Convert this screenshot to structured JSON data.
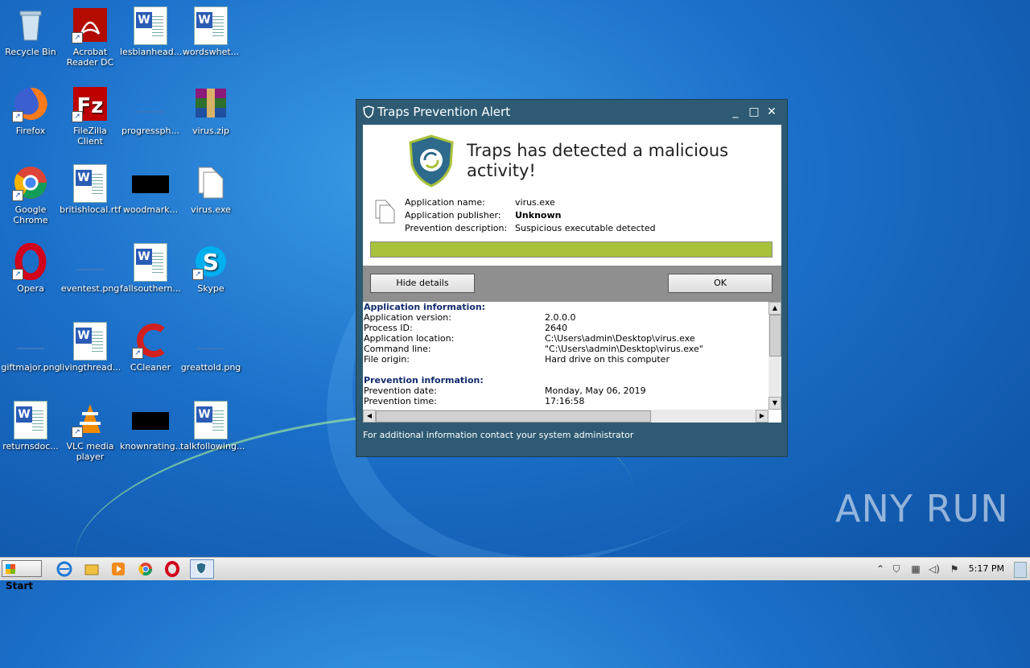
{
  "desktop": {
    "icons": [
      {
        "label": "Recycle Bin",
        "type": "recycle"
      },
      {
        "label": "Acrobat Reader DC",
        "type": "acrobat"
      },
      {
        "label": "lesbianhead...",
        "type": "word"
      },
      {
        "label": "wordswhet...",
        "type": "word"
      },
      {
        "label": "Firefox",
        "type": "firefox"
      },
      {
        "label": "FileZilla Client",
        "type": "filezilla"
      },
      {
        "label": "progressph...",
        "type": "blank"
      },
      {
        "label": "virus.zip",
        "type": "zip"
      },
      {
        "label": "Google Chrome",
        "type": "chrome"
      },
      {
        "label": "britishlocal.rtf",
        "type": "word"
      },
      {
        "label": "woodmark...",
        "type": "black"
      },
      {
        "label": "virus.exe",
        "type": "exe"
      },
      {
        "label": "Opera",
        "type": "opera"
      },
      {
        "label": "eventest.png",
        "type": "blank"
      },
      {
        "label": "fallsouthern...",
        "type": "word"
      },
      {
        "label": "Skype",
        "type": "skype"
      },
      {
        "label": "giftmajor.png",
        "type": "blank"
      },
      {
        "label": "livingthread...",
        "type": "word"
      },
      {
        "label": "CCleaner",
        "type": "ccleaner"
      },
      {
        "label": "greattold.png",
        "type": "blank"
      },
      {
        "label": "returnsdoc...",
        "type": "word"
      },
      {
        "label": "VLC media player",
        "type": "vlc"
      },
      {
        "label": "knownrating...",
        "type": "black"
      },
      {
        "label": "talkfollowing...",
        "type": "word"
      }
    ]
  },
  "dialog": {
    "title": "Traps Prevention Alert",
    "headline": "Traps has detected a malicious activity!",
    "app_name_label": "Application name:",
    "app_name": "virus.exe",
    "publisher_label": "Application publisher:",
    "publisher": "Unknown",
    "prevention_label": "Prevention description:",
    "prevention": "Suspicious executable detected",
    "progress": 1.0,
    "hide_details": "Hide details",
    "ok": "OK",
    "details": {
      "app_section": "Application information:",
      "app_rows": [
        {
          "k": "Application version:",
          "v": "2.0.0.0"
        },
        {
          "k": "Process ID:",
          "v": "2640"
        },
        {
          "k": "Application location:",
          "v": "C:\\Users\\admin\\Desktop\\virus.exe"
        },
        {
          "k": "Command line:",
          "v": "\"C:\\Users\\admin\\Desktop\\virus.exe\""
        },
        {
          "k": "File origin:",
          "v": "Hard drive on this computer"
        }
      ],
      "prev_section": "Prevention information:",
      "prev_rows": [
        {
          "k": "Prevention date:",
          "v": "Monday, May 06, 2019"
        },
        {
          "k": "Prevention time:",
          "v": "17:16:58"
        }
      ]
    },
    "footer": "For additional information contact your system administrator"
  },
  "taskbar": {
    "start": "Start",
    "clock": "5:17 PM"
  },
  "watermark": "ANY RUN"
}
